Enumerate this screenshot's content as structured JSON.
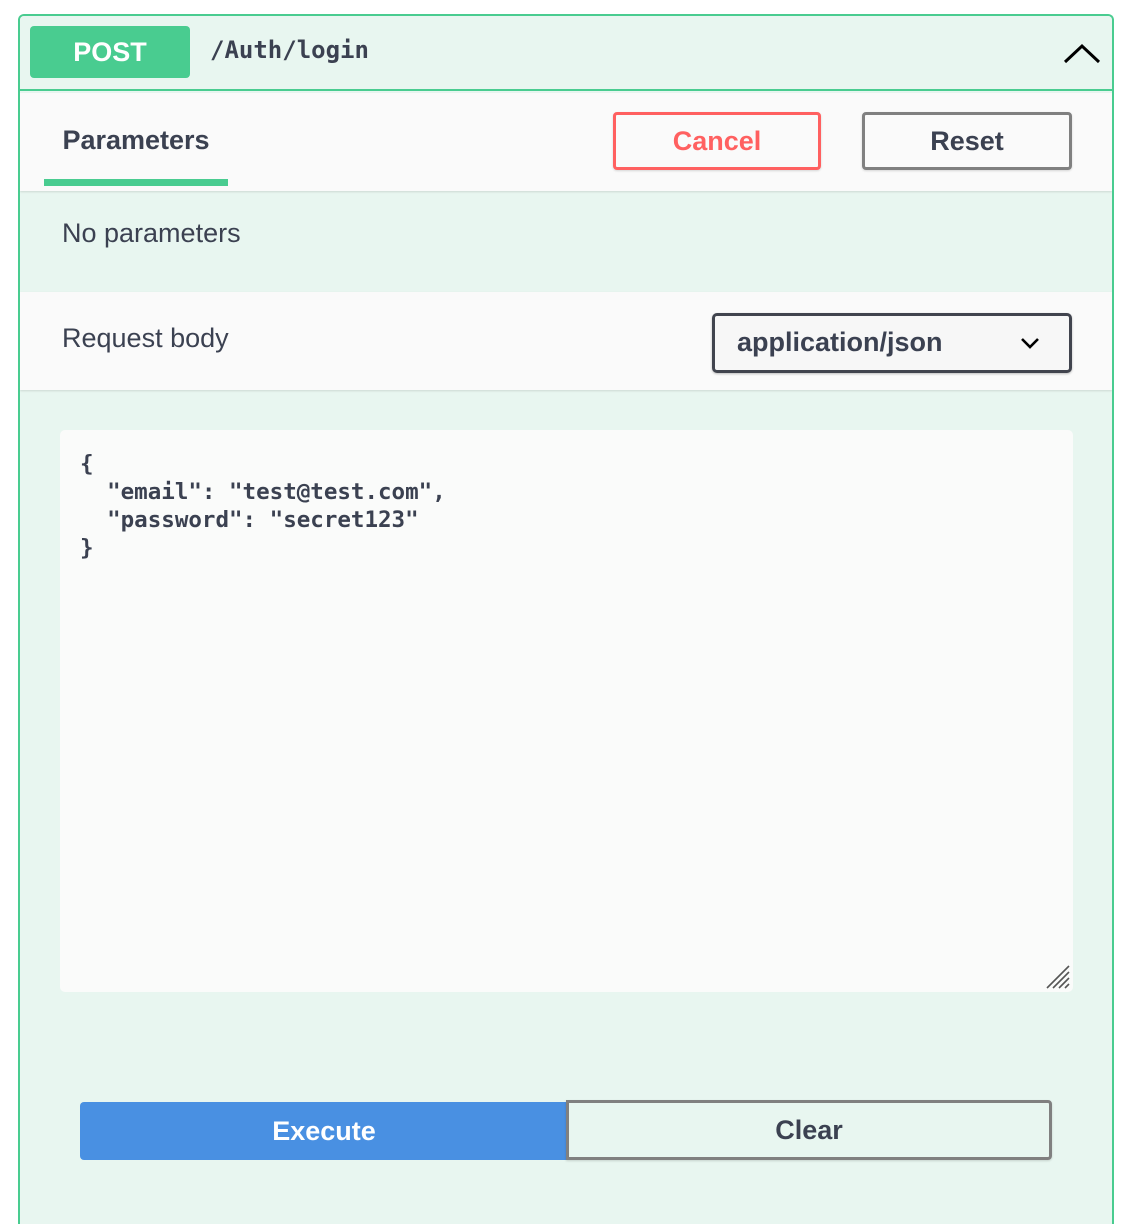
{
  "operation": {
    "method": "POST",
    "path": "/Auth/login",
    "collapse_icon": "chevron-up-icon"
  },
  "parameters": {
    "tab_label": "Parameters",
    "cancel_label": "Cancel",
    "reset_label": "Reset",
    "empty_text": "No parameters"
  },
  "request_body": {
    "label": "Request body",
    "content_type": "application/json",
    "dropdown_icon": "chevron-down-icon",
    "body_text": "{\n  \"email\": \"test@test.com\",\n  \"password\": \"secret123\"\n}"
  },
  "actions": {
    "execute_label": "Execute",
    "clear_label": "Clear"
  },
  "colors": {
    "post_green": "#49cc90",
    "panel_bg": "#e8f6f0",
    "cancel_red": "#ff6060",
    "execute_blue": "#4990e2",
    "text_dark": "#3b4151"
  }
}
